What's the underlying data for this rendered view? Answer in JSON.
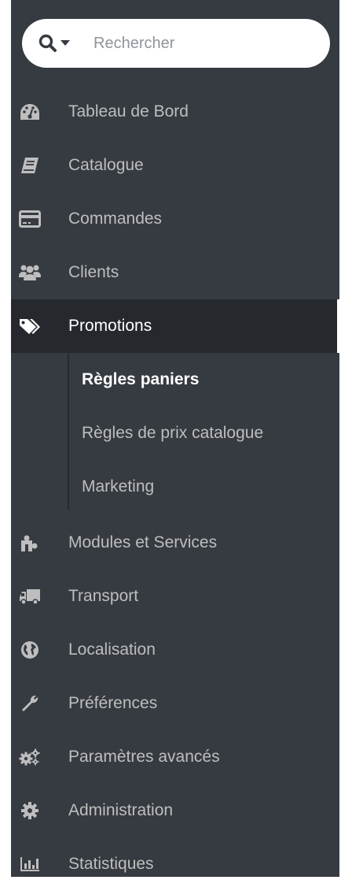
{
  "search": {
    "placeholder": "Rechercher",
    "value": ""
  },
  "menu": {
    "items": [
      {
        "label": "Tableau de Bord",
        "icon": "dashboard-icon"
      },
      {
        "label": "Catalogue",
        "icon": "book-icon"
      },
      {
        "label": "Commandes",
        "icon": "credit-card-icon"
      },
      {
        "label": "Clients",
        "icon": "users-icon"
      },
      {
        "label": "Promotions",
        "icon": "tags-icon",
        "active": true
      }
    ],
    "submenu": [
      {
        "label": "Règles paniers",
        "current": true
      },
      {
        "label": "Règles de prix catalogue"
      },
      {
        "label": "Marketing"
      }
    ],
    "items_after": [
      {
        "label": "Modules et Services",
        "icon": "puzzle-icon"
      },
      {
        "label": "Transport",
        "icon": "truck-icon"
      },
      {
        "label": "Localisation",
        "icon": "globe-icon"
      },
      {
        "label": "Préférences",
        "icon": "wrench-icon"
      },
      {
        "label": "Paramètres avancés",
        "icon": "cogs-icon"
      },
      {
        "label": "Administration",
        "icon": "cog-icon"
      },
      {
        "label": "Statistiques",
        "icon": "bar-chart-icon"
      }
    ]
  },
  "colors": {
    "sidebar_bg": "#363a41",
    "active_bg": "#25282d",
    "text": "#bebebe",
    "text_active": "#ffffff"
  }
}
